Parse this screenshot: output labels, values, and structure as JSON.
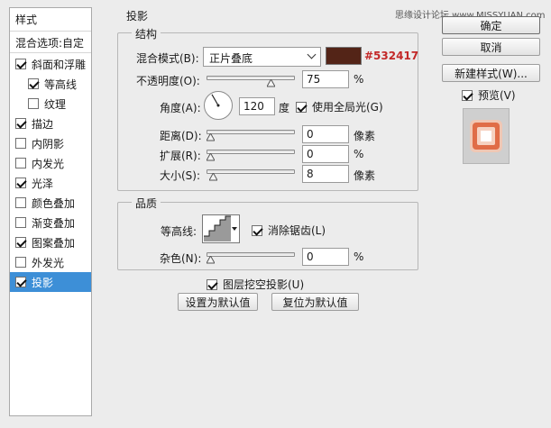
{
  "watermark": "思缘设计论坛  www.MISSYUAN.com",
  "left_panel": {
    "header": "样式",
    "blend_options": "混合选项:自定",
    "items": [
      {
        "label": "斜面和浮雕",
        "checked": true,
        "indent": false,
        "selected": false
      },
      {
        "label": "等高线",
        "checked": true,
        "indent": true,
        "selected": false
      },
      {
        "label": "纹理",
        "checked": false,
        "indent": true,
        "selected": false
      },
      {
        "label": "描边",
        "checked": true,
        "indent": false,
        "selected": false
      },
      {
        "label": "内阴影",
        "checked": false,
        "indent": false,
        "selected": false
      },
      {
        "label": "内发光",
        "checked": false,
        "indent": false,
        "selected": false
      },
      {
        "label": "光泽",
        "checked": true,
        "indent": false,
        "selected": false
      },
      {
        "label": "颜色叠加",
        "checked": false,
        "indent": false,
        "selected": false
      },
      {
        "label": "渐变叠加",
        "checked": false,
        "indent": false,
        "selected": false
      },
      {
        "label": "图案叠加",
        "checked": true,
        "indent": false,
        "selected": false
      },
      {
        "label": "外发光",
        "checked": false,
        "indent": false,
        "selected": false
      },
      {
        "label": "投影",
        "checked": true,
        "indent": false,
        "selected": true
      }
    ]
  },
  "section_title": "投影",
  "structure": {
    "title": "结构",
    "blend_mode_label": "混合模式(B):",
    "blend_mode_value": "正片叠底",
    "color_hex": "#532417",
    "color": "#532417",
    "opacity_label": "不透明度(O):",
    "opacity_value": "75",
    "opacity_unit": "%",
    "opacity_fraction": 0.75,
    "angle_label": "角度(A):",
    "angle_value": "120",
    "angle_unit": "度",
    "global_light_label": "使用全局光(G)",
    "global_light_checked": true,
    "distance_label": "距离(D):",
    "distance_value": "0",
    "distance_unit": "像素",
    "distance_fraction": 0.0,
    "spread_label": "扩展(R):",
    "spread_value": "0",
    "spread_unit": "%",
    "spread_fraction": 0.0,
    "size_label": "大小(S):",
    "size_value": "8",
    "size_unit": "像素",
    "size_fraction": 0.03
  },
  "quality": {
    "title": "品质",
    "contour_label": "等高线:",
    "anti_alias_label": "消除锯齿(L)",
    "anti_alias_checked": true,
    "noise_label": "杂色(N):",
    "noise_value": "0",
    "noise_unit": "%",
    "noise_fraction": 0.0
  },
  "knockout_label": "图层挖空投影(U)",
  "knockout_checked": true,
  "set_default": "设置为默认值",
  "reset_default": "复位为默认值",
  "right": {
    "ok": "确定",
    "cancel": "取消",
    "new_style": "新建样式(W)...",
    "preview_label": "预览(V)",
    "preview_checked": true
  }
}
